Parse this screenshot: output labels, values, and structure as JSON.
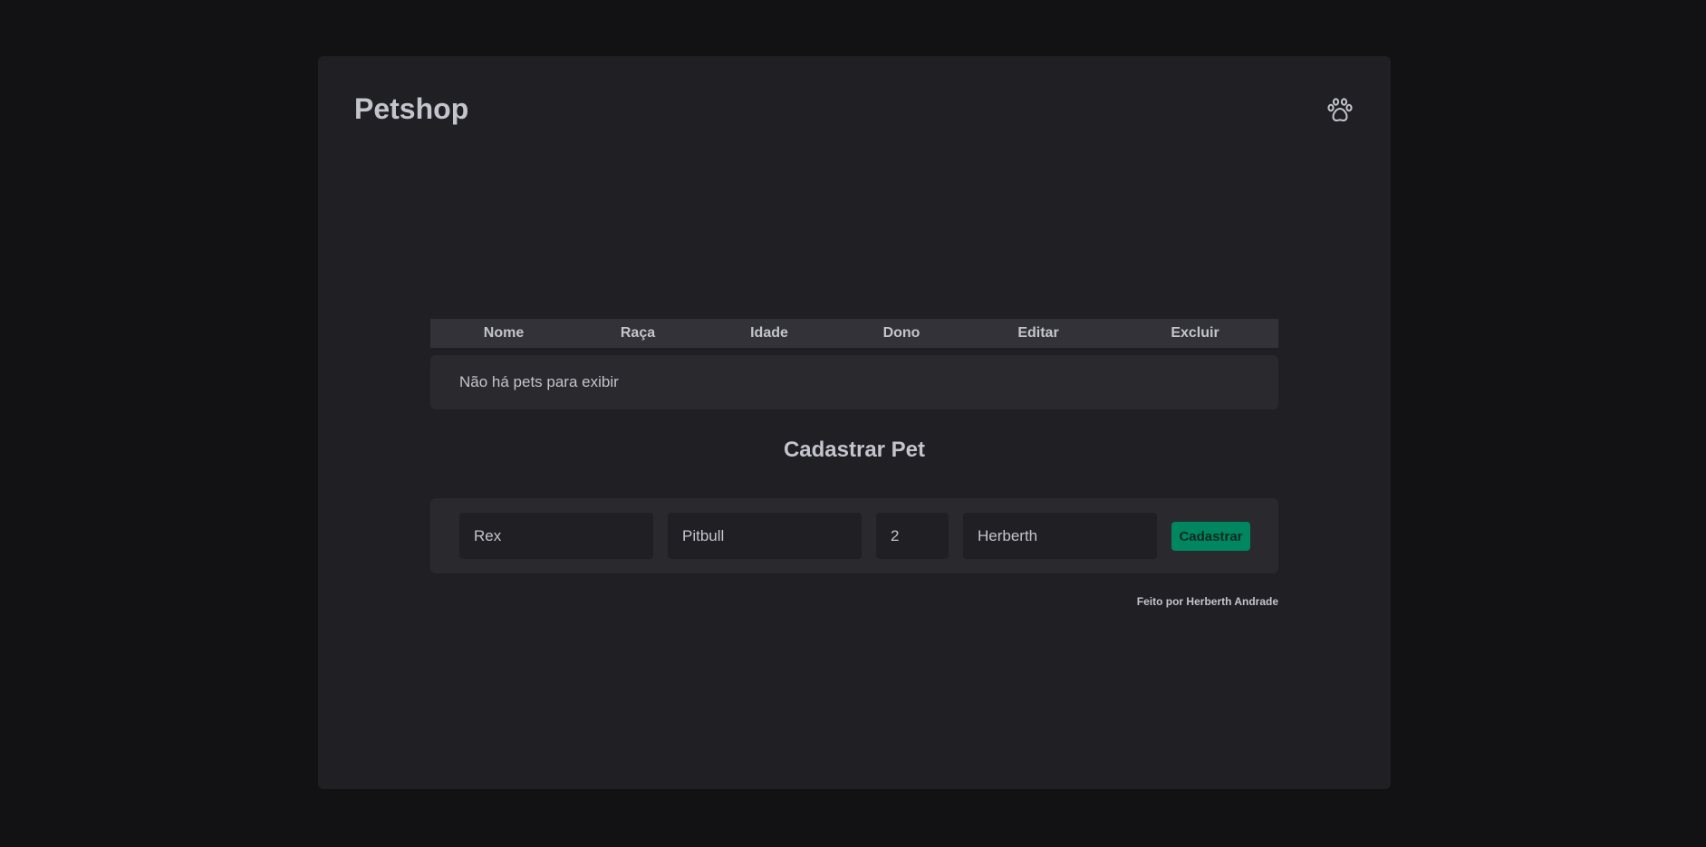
{
  "header": {
    "title": "Petshop",
    "icon": "paw-icon"
  },
  "table": {
    "columns": [
      "Nome",
      "Raça",
      "Idade",
      "Dono",
      "Editar",
      "Excluir"
    ],
    "empty_message": "Não há pets para exibir"
  },
  "form": {
    "title": "Cadastrar Pet",
    "fields": {
      "nome": "Rex",
      "raca": "Pitbull",
      "idade": "2",
      "dono": "Herberth"
    },
    "submit_label": "Cadastrar"
  },
  "footer": {
    "credit": "Feito por Herberth Andrade"
  },
  "colors": {
    "background": "#121214",
    "card": "#202024",
    "accent": "#00875f"
  }
}
